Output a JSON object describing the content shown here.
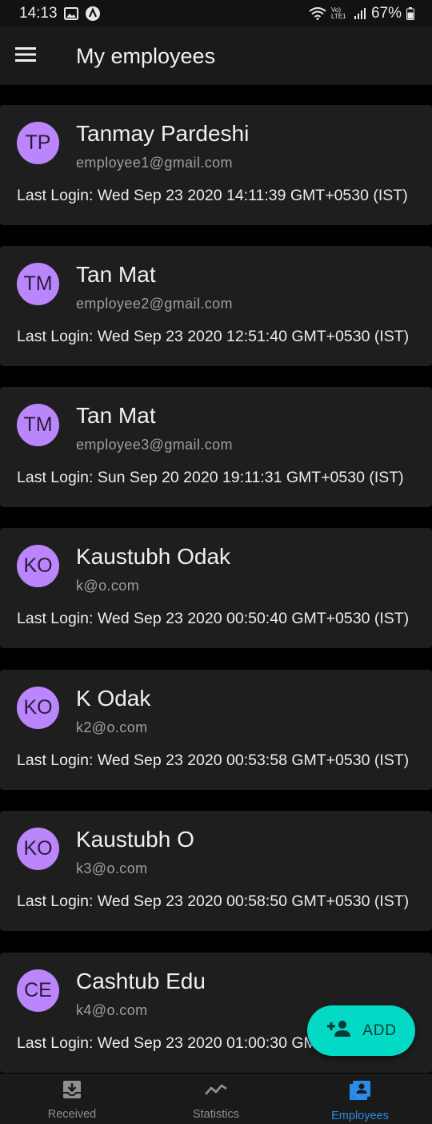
{
  "status_bar": {
    "time": "14:13",
    "network_label": "Vo) LTE1",
    "battery": "67%"
  },
  "app_bar": {
    "title": "My employees",
    "menu_icon": "hamburger-menu-icon"
  },
  "employees": [
    {
      "initials": "TP",
      "name": "Tanmay Pardeshi",
      "email": "employee1@gmail.com",
      "last_login": "Last Login: Wed Sep 23 2020 14:11:39 GMT+0530 (IST)"
    },
    {
      "initials": "TM",
      "name": "Tan Mat",
      "email": "employee2@gmail.com",
      "last_login": "Last Login: Wed Sep 23 2020 12:51:40 GMT+0530 (IST)"
    },
    {
      "initials": "TM",
      "name": "Tan Mat",
      "email": "employee3@gmail.com",
      "last_login": "Last Login: Sun Sep 20 2020 19:11:31 GMT+0530 (IST)"
    },
    {
      "initials": "KO",
      "name": "Kaustubh Odak",
      "email": "k@o.com",
      "last_login": "Last Login: Wed Sep 23 2020 00:50:40 GMT+0530 (IST)"
    },
    {
      "initials": "KO",
      "name": "K Odak",
      "email": "k2@o.com",
      "last_login": "Last Login: Wed Sep 23 2020 00:53:58 GMT+0530 (IST)"
    },
    {
      "initials": "KO",
      "name": "Kaustubh O",
      "email": "k3@o.com",
      "last_login": "Last Login: Wed Sep 23 2020 00:58:50 GMT+0530 (IST)"
    },
    {
      "initials": "CE",
      "name": "Cashtub Edu",
      "email": "k4@o.com",
      "last_login": "Last Login: Wed Sep 23 2020 01:00:30 GMT+0530 (IST)"
    }
  ],
  "fab": {
    "label": "ADD",
    "icon": "add-person-icon"
  },
  "bottom_nav": {
    "items": [
      {
        "label": "Received",
        "icon": "inbox-download-icon",
        "active": false
      },
      {
        "label": "Statistics",
        "icon": "trending-line-icon",
        "active": false
      },
      {
        "label": "Employees",
        "icon": "contacts-icon",
        "active": true
      }
    ]
  },
  "colors": {
    "background": "#000000",
    "card": "#1e1e1e",
    "avatar": "#bb86fc",
    "fab": "#03dac5",
    "active_nav": "#2b8be6"
  }
}
